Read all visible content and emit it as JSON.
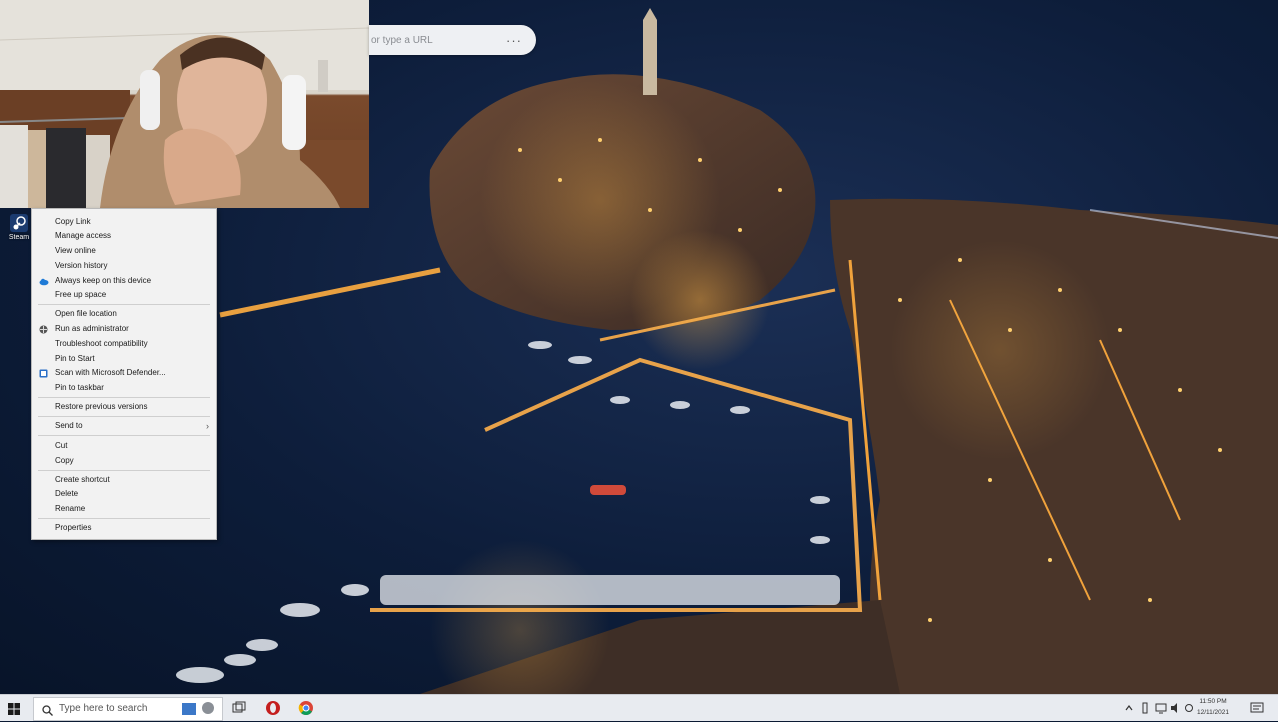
{
  "browser": {
    "address_placeholder": "or type a URL",
    "more_glyph": "···"
  },
  "desktop": {
    "icon_label": "Steam"
  },
  "context_menu": {
    "items": [
      {
        "label": "Copy Link",
        "icon": "none"
      },
      {
        "label": "Manage access",
        "icon": "none"
      },
      {
        "label": "View online",
        "icon": "none"
      },
      {
        "label": "Version history",
        "icon": "none"
      },
      {
        "label": "Always keep on this device",
        "icon": "onedrive-cloud-icon"
      },
      {
        "label": "Free up space",
        "icon": "none"
      },
      {
        "label": "Open file location",
        "icon": "none"
      },
      {
        "label": "Run as administrator",
        "icon": "shield-icon"
      },
      {
        "label": "Troubleshoot compatibility",
        "icon": "none"
      },
      {
        "label": "Pin to Start",
        "icon": "none"
      },
      {
        "label": "Scan with Microsoft Defender...",
        "icon": "defender-icon"
      },
      {
        "label": "Pin to taskbar",
        "icon": "none"
      },
      {
        "label": "Restore previous versions",
        "icon": "none"
      },
      {
        "label": "Send to",
        "icon": "none",
        "submenu": true
      },
      {
        "label": "Cut",
        "icon": "none"
      },
      {
        "label": "Copy",
        "icon": "none"
      },
      {
        "label": "Create shortcut",
        "icon": "none"
      },
      {
        "label": "Delete",
        "icon": "none"
      },
      {
        "label": "Rename",
        "icon": "none"
      },
      {
        "label": "Properties",
        "icon": "none"
      }
    ],
    "submenu_arrow": "›"
  },
  "taskbar": {
    "search_placeholder": "Type here to search",
    "clock_time": "11:50 PM",
    "clock_date": "12/11/2021",
    "pinned": [
      "task-view-icon",
      "opera-icon",
      "chrome-icon"
    ]
  },
  "colors": {
    "menu_bg": "#f2f2f2",
    "taskbar_bg": "#e8ebf0",
    "wallpaper_sea": "#0d1d3a",
    "city_lights": "#f0a23c"
  }
}
